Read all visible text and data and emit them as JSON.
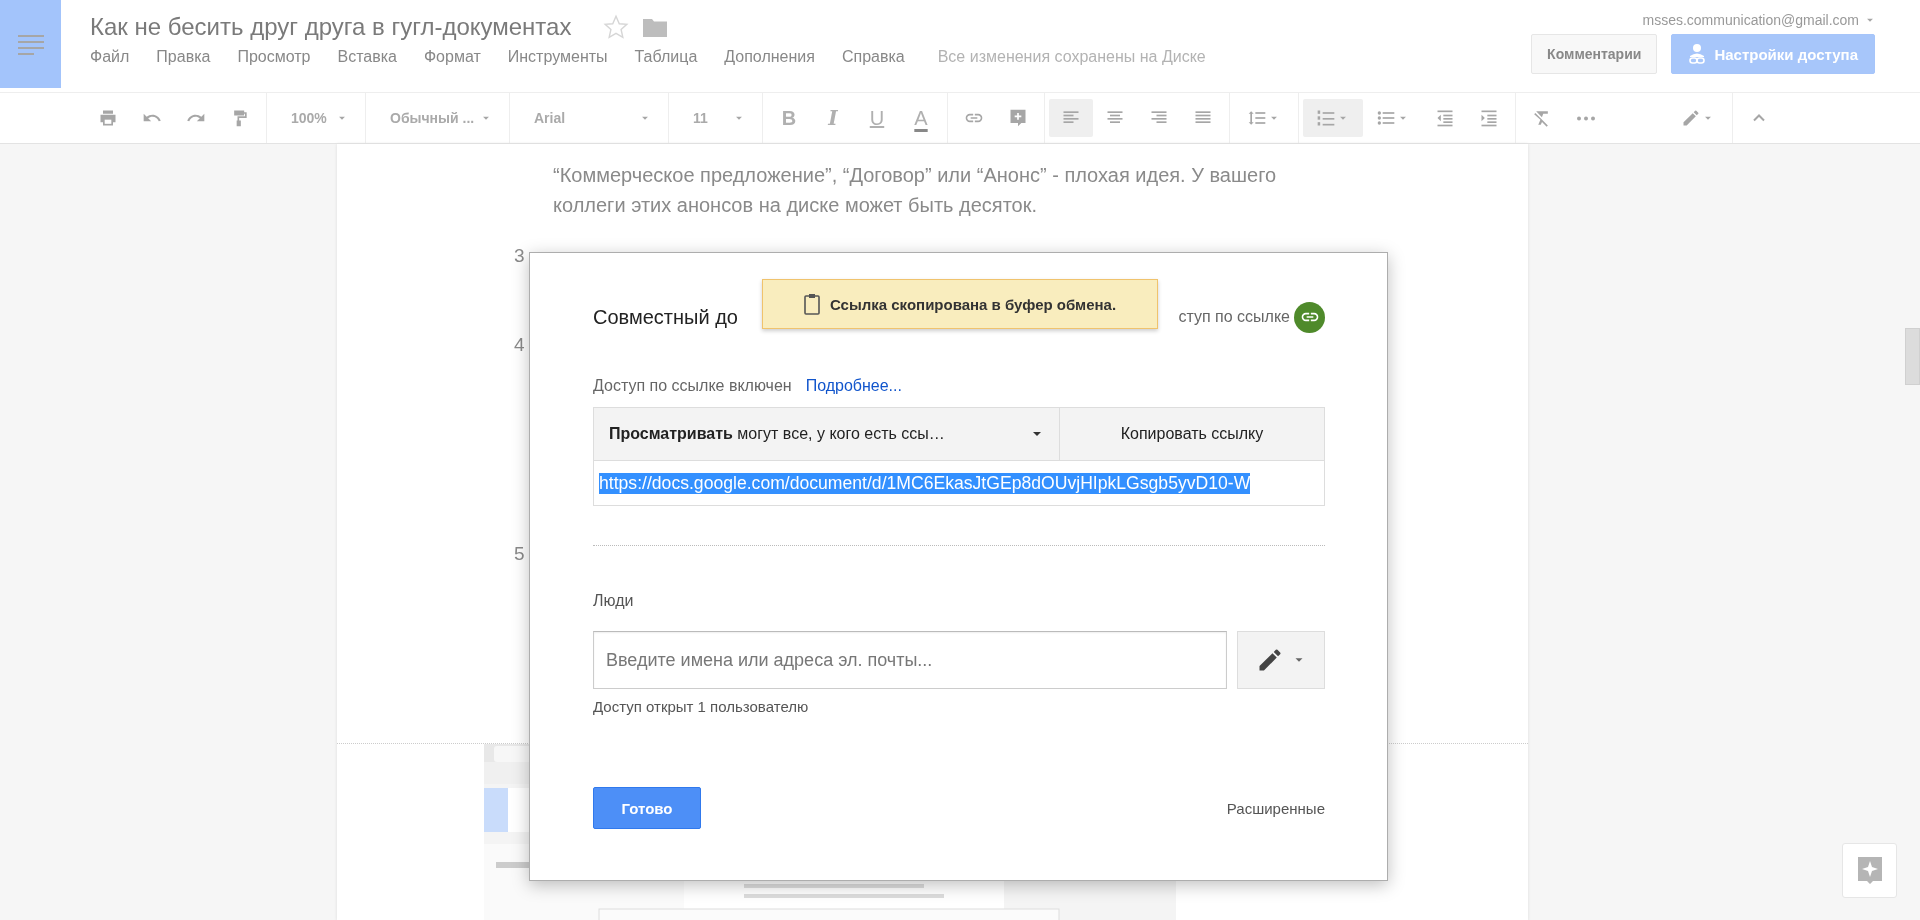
{
  "header": {
    "title": "Как не бесить друг друга в гугл-документах",
    "starred": false,
    "account": "msses.communication@gmail.com",
    "menu": [
      "Файл",
      "Правка",
      "Просмотр",
      "Вставка",
      "Формат",
      "Инструменты",
      "Таблица",
      "Дополнения",
      "Справка"
    ],
    "save_status": "Все изменения сохранены на Диске",
    "comments_button": "Комментарии",
    "share_button": "Настройки доступа"
  },
  "toolbar": {
    "zoom": "100%",
    "style": "Обычный ...",
    "font": "Arial",
    "size": "11",
    "format_buttons": [
      "B",
      "I",
      "U",
      "A"
    ],
    "align": [
      {
        "selected": true
      },
      {
        "selected": false
      },
      {
        "selected": false
      },
      {
        "selected": false
      }
    ],
    "lists": [
      {
        "selected": true
      },
      {
        "selected": false
      }
    ]
  },
  "document": {
    "lines": [
      "“Коммерческое предложение”, “Договор” или “Анонс” - плохая идея. У вашего",
      "коллеги этих анонсов на диске может быть десяток."
    ],
    "markers": [
      "3",
      "4",
      "5"
    ]
  },
  "dialog": {
    "title": "Совместный до",
    "link_label": "ступ по ссылке",
    "link_on": true,
    "link_status": "Доступ по ссылке включен",
    "learn_more": "Подробнее...",
    "permission": "**Просматривать** могут все, у кого есть ссы…",
    "copy_button": "Копировать ссылку",
    "url": "https://docs.google.com/document/d/1MC6EkasJtGEp8dOUvjHIpkLGsgb5yvD10-W",
    "url_selected": true,
    "people_label": "Люди",
    "people_placeholder": "Введите имена или адреса эл. почты...",
    "shared_count": "Доступ открыт 1 пользователю",
    "done_button": "Готово",
    "advanced_link": "Расширенные"
  },
  "toast": "Ссылка скопирована в буфер обмена."
}
